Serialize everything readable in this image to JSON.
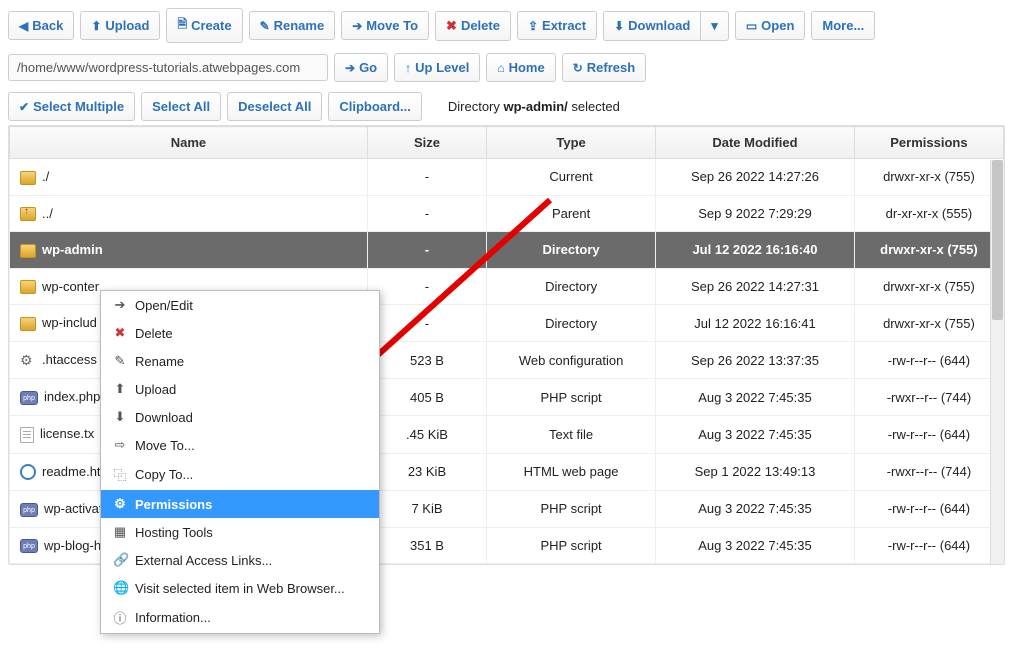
{
  "toolbar": {
    "back": "Back",
    "upload": "Upload",
    "create": "Create",
    "rename": "Rename",
    "moveto": "Move To",
    "delete": "Delete",
    "extract": "Extract",
    "download": "Download",
    "open": "Open",
    "more": "More..."
  },
  "path": "/home/www/wordpress-tutorials.atwebpages.com",
  "nav": {
    "go": "Go",
    "uplevel": "Up Level",
    "home": "Home",
    "refresh": "Refresh"
  },
  "selection": {
    "multiple": "Select Multiple",
    "all": "Select All",
    "none": "Deselect All",
    "clipboard": "Clipboard...",
    "status_prefix": "Directory ",
    "status_bold": "wp-admin/",
    "status_suffix": " selected"
  },
  "columns": {
    "name": "Name",
    "size": "Size",
    "type": "Type",
    "date": "Date Modified",
    "perm": "Permissions"
  },
  "rows": [
    {
      "icon": "folder",
      "name": "./",
      "size": "-",
      "type": "Current",
      "date": "Sep 26 2022 14:27:26",
      "perm": "drwxr-xr-x (755)"
    },
    {
      "icon": "up",
      "name": "../",
      "size": "-",
      "type": "Parent",
      "date": "Sep 9 2022 7:29:29",
      "perm": "dr-xr-xr-x (555)"
    },
    {
      "icon": "folder",
      "name": "wp-admin",
      "size": "-",
      "type": "Directory",
      "date": "Jul 12 2022 16:16:40",
      "perm": "drwxr-xr-x (755)",
      "selected": true
    },
    {
      "icon": "folder",
      "name": "wp-content",
      "size": "-",
      "type": "Directory",
      "date": "Sep 26 2022 14:27:31",
      "perm": "drwxr-xr-x (755)",
      "truncated": "wp-conter"
    },
    {
      "icon": "folder",
      "name": "wp-includes",
      "size": "-",
      "type": "Directory",
      "date": "Jul 12 2022 16:16:41",
      "perm": "drwxr-xr-x (755)",
      "truncated": "wp-includ"
    },
    {
      "icon": "gear",
      "name": ".htaccess",
      "size": "523 B",
      "type": "Web configuration",
      "date": "Sep 26 2022 13:37:35",
      "perm": "-rw-r--r-- (644)"
    },
    {
      "icon": "php",
      "name": "index.php",
      "size": "405 B",
      "type": "PHP script",
      "date": "Aug 3 2022 7:45:35",
      "perm": "-rwxr--r-- (744)"
    },
    {
      "icon": "txt",
      "name": "license.tx",
      "size": ".45 KiB",
      "type": "Text file",
      "date": "Aug 3 2022 7:45:35",
      "perm": "-rw-r--r-- (644)"
    },
    {
      "icon": "html",
      "name": "readme.ht",
      "size": "23 KiB",
      "type": "HTML web page",
      "date": "Sep 1 2022 13:49:13",
      "perm": "-rwxr--r-- (744)"
    },
    {
      "icon": "php",
      "name": "wp-activate.php",
      "size": "7 KiB",
      "type": "PHP script",
      "date": "Aug 3 2022 7:45:35",
      "perm": "-rw-r--r-- (644)"
    },
    {
      "icon": "php",
      "name": "wp-blog-header.php",
      "size": "351 B",
      "type": "PHP script",
      "date": "Aug 3 2022 7:45:35",
      "perm": "-rw-r--r-- (644)"
    }
  ],
  "context_menu": [
    {
      "icon": "➔",
      "label": "Open/Edit"
    },
    {
      "icon": "✖",
      "label": "Delete",
      "color": "#c33"
    },
    {
      "icon": "✎",
      "label": "Rename"
    },
    {
      "icon": "⬆",
      "label": "Upload"
    },
    {
      "icon": "⬇",
      "label": "Download"
    },
    {
      "icon": "⇨",
      "label": "Move To..."
    },
    {
      "icon": "⿻",
      "label": "Copy To..."
    },
    {
      "icon": "⚙",
      "label": "Permissions",
      "highlight": true
    },
    {
      "icon": "▦",
      "label": "Hosting Tools"
    },
    {
      "icon": "🔗",
      "label": "External Access Links..."
    },
    {
      "icon": "🌐",
      "label": "Visit selected item in Web Browser..."
    },
    {
      "icon": "ⓘ",
      "label": "Information..."
    }
  ]
}
